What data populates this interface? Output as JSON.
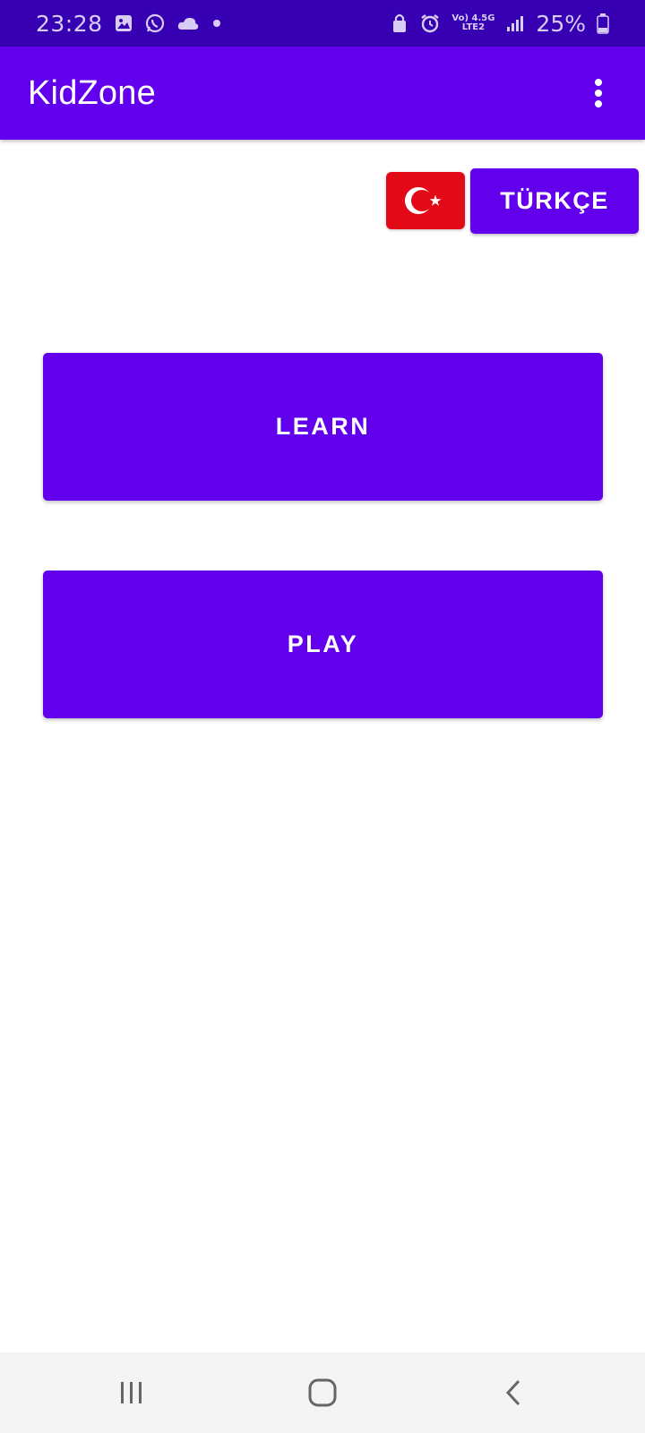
{
  "status_bar": {
    "time": "23:28",
    "battery_percent": "25%",
    "network_top": "Vo) 4.5G",
    "network_bottom": "LTE2",
    "icons": [
      "gallery-icon",
      "whatsapp-icon",
      "cloud-icon",
      "dot-icon",
      "lock-icon",
      "alarm-icon",
      "signal-icon",
      "battery-icon"
    ]
  },
  "app_bar": {
    "title": "KidZone",
    "overflow_icon": "more-vert-icon"
  },
  "language": {
    "flag": "turkey-flag-icon",
    "label": "TÜRKÇE"
  },
  "main": {
    "learn_label": "LEARN",
    "play_label": "PLAY"
  },
  "nav_bar": {
    "icons": [
      "recents-icon",
      "home-icon",
      "back-icon"
    ]
  },
  "colors": {
    "status_bar": "#3700b3",
    "primary": "#6200ee",
    "flag_red": "#e30a17",
    "background": "#ffffff",
    "nav_bar": "#f4f4f4"
  }
}
